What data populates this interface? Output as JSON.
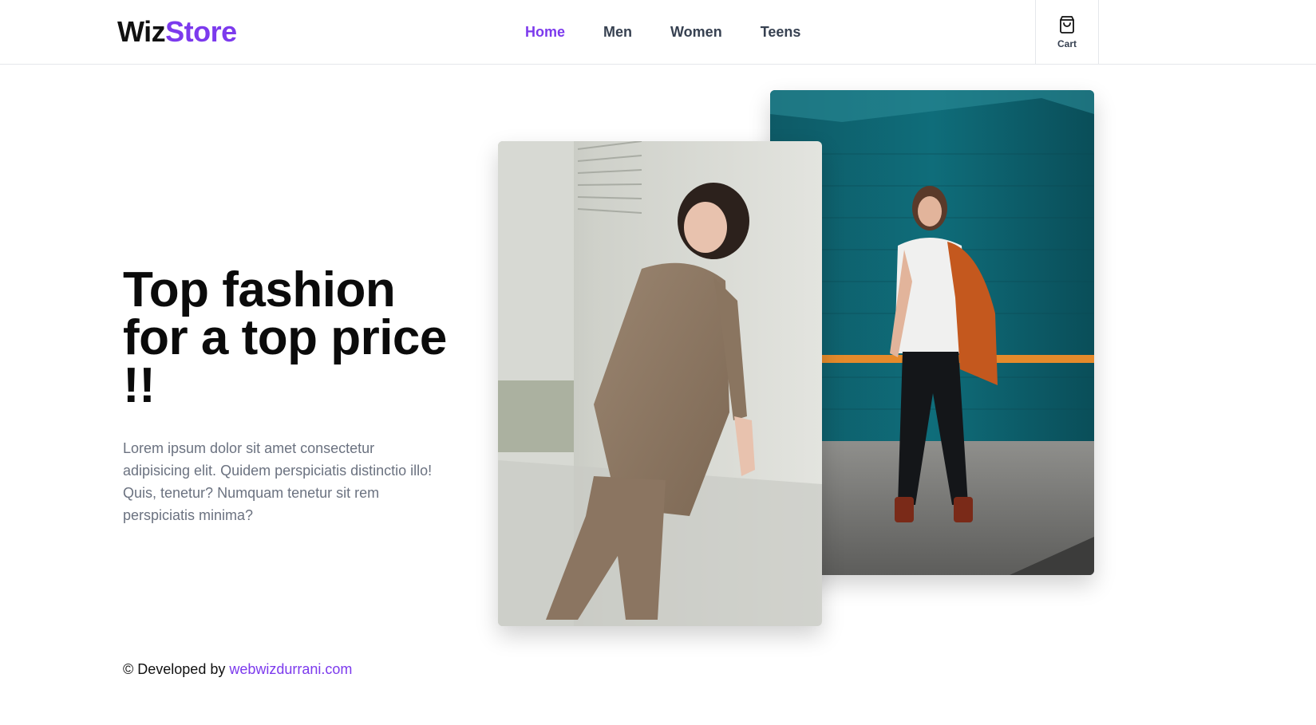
{
  "header": {
    "logo": {
      "part1": "Wiz",
      "part2": "Store"
    },
    "nav": [
      {
        "label": "Home",
        "active": true
      },
      {
        "label": "Men",
        "active": false
      },
      {
        "label": "Women",
        "active": false
      },
      {
        "label": "Teens",
        "active": false
      }
    ],
    "cart": {
      "label": "Cart",
      "icon": "shopping-bag-icon"
    }
  },
  "hero": {
    "title": "Top fashion for a top price !!",
    "description": "Lorem ipsum dolor sit amet consectetur adipisicing elit. Quidem perspiciatis distinctio illo! Quis, tenetur? Numquam tenetur sit rem perspiciatis minima?"
  },
  "footer": {
    "prefix": "© Developed by",
    "link_text": "webwizdurrani.com"
  },
  "colors": {
    "accent": "#7c3aed",
    "text": "#111111",
    "muted": "#6b7280",
    "border": "#e5e7eb"
  }
}
